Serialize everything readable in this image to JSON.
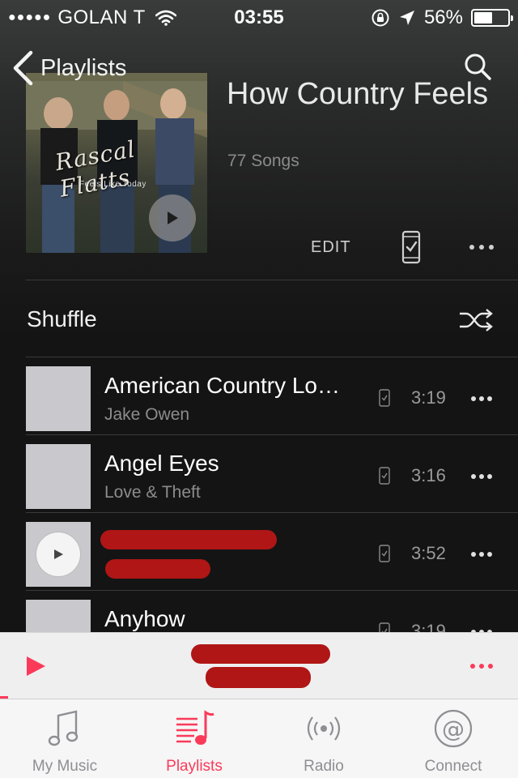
{
  "status_bar": {
    "signal": "●●●●●",
    "carrier": "GOLAN T",
    "time": "03:55",
    "battery": "56%",
    "battery_level": 0.56
  },
  "nav": {
    "back_label": "Playlists",
    "back_icon": "chevron-left-icon",
    "search_icon": "search-icon"
  },
  "playlist": {
    "title": "How Country Feels",
    "count": "77 Songs",
    "album_logo": "Rascal Flatts",
    "album_subtitle": "Feels Like Today",
    "edit_label": "EDIT"
  },
  "shuffle": {
    "label": "Shuffle"
  },
  "songs": [
    {
      "title": "American Country Lo…",
      "artist": "Jake Owen",
      "duration": "3:19"
    },
    {
      "title": "Angel Eyes",
      "artist": "Love & Theft",
      "duration": "3:16"
    },
    {
      "title": "",
      "artist": "",
      "duration": "3:52",
      "redacted": true
    },
    {
      "title": "Anyhow",
      "artist": "",
      "duration": "3:19"
    }
  ],
  "mini_player": {
    "redacted": true,
    "progress": 0.015
  },
  "tabs": [
    {
      "label": "My Music",
      "icon": "music-note-icon",
      "active": false
    },
    {
      "label": "Playlists",
      "icon": "playlist-icon",
      "active": true
    },
    {
      "label": "Radio",
      "icon": "radio-icon",
      "active": false
    },
    {
      "label": "Connect",
      "icon": "at-sign-icon",
      "active": false
    }
  ],
  "colors": {
    "accent": "#fb3a5a",
    "redaction": "#b01616",
    "background": "#151515"
  }
}
